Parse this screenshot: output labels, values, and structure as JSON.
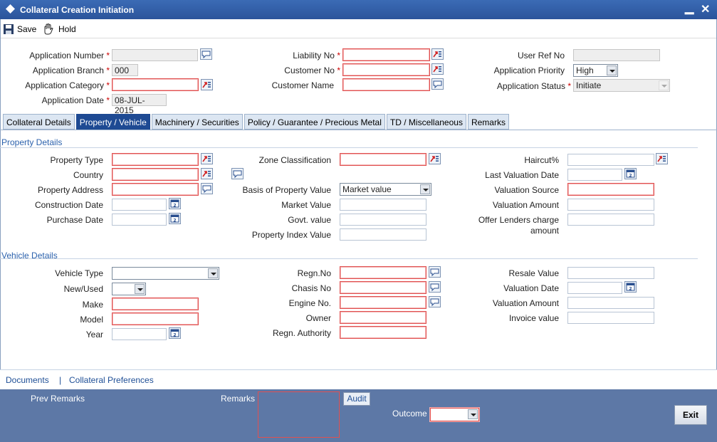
{
  "window": {
    "title": "Collateral Creation Initiation",
    "minimize": "▁",
    "close": "✕"
  },
  "toolbar": {
    "save_label": "Save",
    "hold_label": "Hold"
  },
  "header": {
    "application_number_label": "Application Number",
    "application_branch_label": "Application Branch",
    "application_branch_value": "000",
    "application_category_label": "Application Category",
    "application_date_label": "Application Date",
    "application_date_value": "08-JUL-2015",
    "liability_no_label": "Liability No",
    "customer_no_label": "Customer No",
    "customer_name_label": "Customer Name",
    "user_ref_no_label": "User Ref No",
    "application_priority_label": "Application Priority",
    "application_priority_value": "High",
    "application_status_label": "Application Status",
    "application_status_value": "Initiate",
    "required_mark": "*"
  },
  "tabs": [
    {
      "label": "Collateral Details"
    },
    {
      "label": "Property / Vehicle"
    },
    {
      "label": "Machinery / Securities"
    },
    {
      "label": "Policy / Guarantee / Precious Metal"
    },
    {
      "label": "TD / Miscellaneous"
    },
    {
      "label": "Remarks"
    }
  ],
  "property": {
    "section_title": "Property Details",
    "property_type_label": "Property Type",
    "country_label": "Country",
    "property_address_label": "Property Address",
    "construction_date_label": "Construction Date",
    "purchase_date_label": "Purchase Date",
    "zone_classification_label": "Zone Classification",
    "basis_label": "Basis of Property Value",
    "basis_value": "Market value",
    "market_value_label": "Market Value",
    "govt_value_label": "Govt. value",
    "property_index_label": "Property Index Value",
    "haircut_label": "Haircut%",
    "last_valuation_date_label": "Last Valuation Date",
    "valuation_source_label": "Valuation Source",
    "valuation_amount_label": "Valuation Amount",
    "offer_lenders_label_1": "Offer Lenders charge",
    "offer_lenders_label_2": "amount"
  },
  "vehicle": {
    "section_title": "Vehicle Details",
    "vehicle_type_label": "Vehicle Type",
    "new_used_label": "New/Used",
    "make_label": "Make",
    "model_label": "Model",
    "year_label": "Year",
    "regn_no_label": "Regn.No",
    "chasis_no_label": "Chasis No",
    "engine_no_label": "Engine No.",
    "owner_label": "Owner",
    "regn_authority_label": "Regn. Authority",
    "resale_value_label": "Resale Value",
    "valuation_date_label": "Valuation Date",
    "valuation_amount_label": "Valuation Amount",
    "invoice_value_label": "Invoice value"
  },
  "links": {
    "documents": "Documents",
    "separator": "|",
    "collateral_preferences": "Collateral Preferences"
  },
  "footer": {
    "prev_remarks_label": "Prev Remarks",
    "remarks_label": "Remarks",
    "audit_label": "Audit",
    "outcome_label": "Outcome",
    "exit_label": "Exit"
  },
  "colors": {
    "title_bar": "#2b549b",
    "active_tab": "#1e4a93",
    "section_text": "#2c62ad",
    "footer_bg": "#5d78a6",
    "mandatory_border": "#e05050"
  }
}
